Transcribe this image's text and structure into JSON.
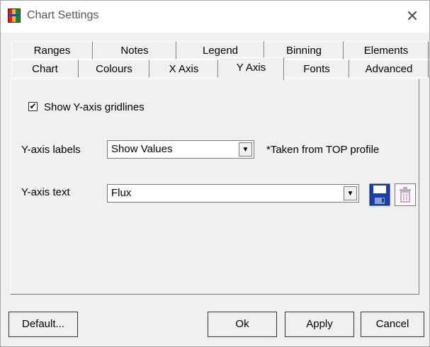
{
  "window": {
    "title": "Chart Settings"
  },
  "tabs_row1": [
    "Ranges",
    "Notes",
    "Legend",
    "Binning",
    "Elements"
  ],
  "tabs_row2": [
    "Chart",
    "Colours",
    "X Axis",
    "Y Axis",
    "Fonts",
    "Advanced"
  ],
  "selected_tab": "Y Axis",
  "y_axis": {
    "gridlines_label": "Show Y-axis gridlines",
    "gridlines_checked": true,
    "labels_label": "Y-axis labels",
    "labels_value": "Show Values",
    "labels_note": "*Taken from TOP profile",
    "text_label": "Y-axis text",
    "text_value": "Flux"
  },
  "buttons": {
    "default": "Default...",
    "ok": "Ok",
    "apply": "Apply",
    "cancel": "Cancel"
  },
  "icons": {
    "app": "app-logo-icon",
    "close": "close-icon",
    "save": "save-floppy-icon",
    "delete": "trash-icon",
    "dropdown": "dropdown-arrow-icon"
  }
}
